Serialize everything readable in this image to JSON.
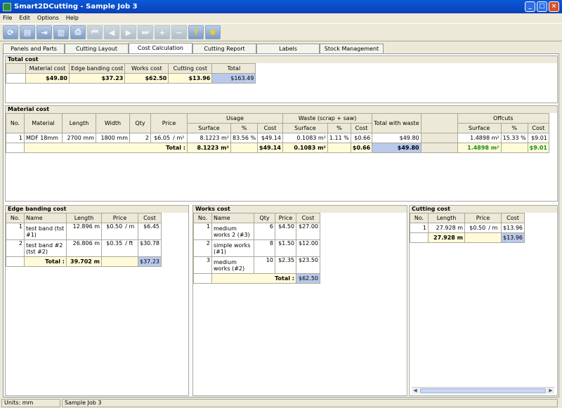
{
  "window": {
    "title": "Smart2DCutting - Sample Job 3"
  },
  "menu": [
    "File",
    "Edit",
    "Options",
    "Help"
  ],
  "toolbar": [
    "refresh-icon",
    "stock-icon",
    "export-icon",
    "book-icon",
    "print-icon",
    "first-icon",
    "prev-icon",
    "next-icon",
    "last-icon",
    "zoom-in-icon",
    "zoom-out-icon",
    "help-icon",
    "tools-icon"
  ],
  "tabs": [
    "Panels and Parts",
    "Cutting Layout",
    "Cost Calculation",
    "Cutting Report",
    "Labels",
    "Stock Management"
  ],
  "total_cost": {
    "title": "Total cost",
    "headers": [
      "Material cost",
      "Edge banding cost",
      "Works cost",
      "Cutting cost",
      "Total"
    ],
    "values": [
      "$49.80",
      "$37.23",
      "$62.50",
      "$13.96",
      "$163.49"
    ]
  },
  "material": {
    "title": "Material cost",
    "groups": [
      "Usage",
      "Waste  (scrap + saw)",
      "Offcuts"
    ],
    "headers": [
      "No.",
      "Material",
      "Length",
      "Width",
      "Qty",
      "Price",
      "Surface",
      "%",
      "Cost",
      "Surface",
      "%",
      "Cost",
      "Total with waste",
      "Surface",
      "%",
      "Cost"
    ],
    "rows": [
      [
        "1",
        "MDF 18mm",
        "2700 mm",
        "1800 mm",
        "2",
        "$6.05",
        "/ m²",
        "8.1223 m²",
        "83.56 %",
        "$49.14",
        "0.1083 m²",
        "1.11 %",
        "$0.66",
        "$49.80",
        "1.4898 m²",
        "15.33 %",
        "$9.01"
      ]
    ],
    "total": {
      "label": "Total :",
      "surface": "8.1223 m²",
      "cost": "$49.14",
      "waste_surface": "0.1083 m²",
      "waste_cost": "$0.66",
      "with_waste": "$49.80",
      "offcut_surface": "1.4898 m²",
      "offcut_cost": "$9.01"
    }
  },
  "edge": {
    "title": "Edge banding cost",
    "headers": [
      "No.",
      "Name",
      "Length",
      "Price",
      "Cost"
    ],
    "rows": [
      [
        "1",
        "test band (tst #1)",
        "12.896 m",
        "$0.50",
        "/ m",
        "$6.45"
      ],
      [
        "2",
        "test band #2 (tst #2)",
        "26.806 m",
        "$0.35",
        "/ ft",
        "$30.78"
      ]
    ],
    "total": {
      "label": "Total :",
      "length": "39.702 m",
      "cost": "$37.23"
    }
  },
  "works": {
    "title": "Works cost",
    "headers": [
      "No.",
      "Name",
      "Qty",
      "Price",
      "Cost"
    ],
    "rows": [
      [
        "1",
        "medium works 2 (#3)",
        "6",
        "$4.50",
        "$27.00"
      ],
      [
        "2",
        "simple works (#1)",
        "8",
        "$1.50",
        "$12.00"
      ],
      [
        "3",
        "medium works (#2)",
        "10",
        "$2.35",
        "$23.50"
      ]
    ],
    "total": {
      "label": "Total :",
      "cost": "$62.50"
    }
  },
  "cutting": {
    "title": "Cutting cost",
    "headers": [
      "No.",
      "Length",
      "Price",
      "Cost"
    ],
    "rows": [
      [
        "1",
        "27.928 m",
        "$0.50",
        "/ m",
        "$13.96"
      ]
    ],
    "total": {
      "length": "27.928 m",
      "cost": "$13.96"
    }
  },
  "status": {
    "units": "Units: mm",
    "job": "Sample Job 3"
  }
}
